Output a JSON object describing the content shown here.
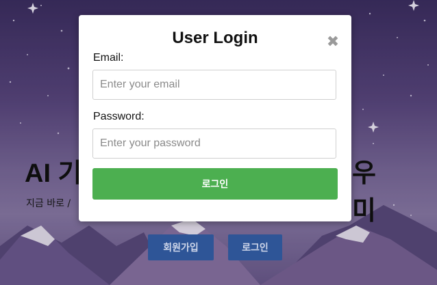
{
  "hero": {
    "title": "AI 기",
    "title_tail": "우미",
    "subtitle": "지금 바로 /",
    "signup_label": "회원가입",
    "login_label": "로그인"
  },
  "modal": {
    "title": "User Login",
    "close_glyph": "✖",
    "email_label": "Email:",
    "email_placeholder": "Enter your email",
    "email_value": "",
    "password_label": "Password:",
    "password_placeholder": "Enter your password",
    "password_value": "",
    "submit_label": "로그인"
  },
  "colors": {
    "submit_bg": "#4caf50",
    "hero_button_bg": "#2e5597",
    "sky_top": "#3d2f63",
    "sky_bottom": "#8a7aa8"
  }
}
